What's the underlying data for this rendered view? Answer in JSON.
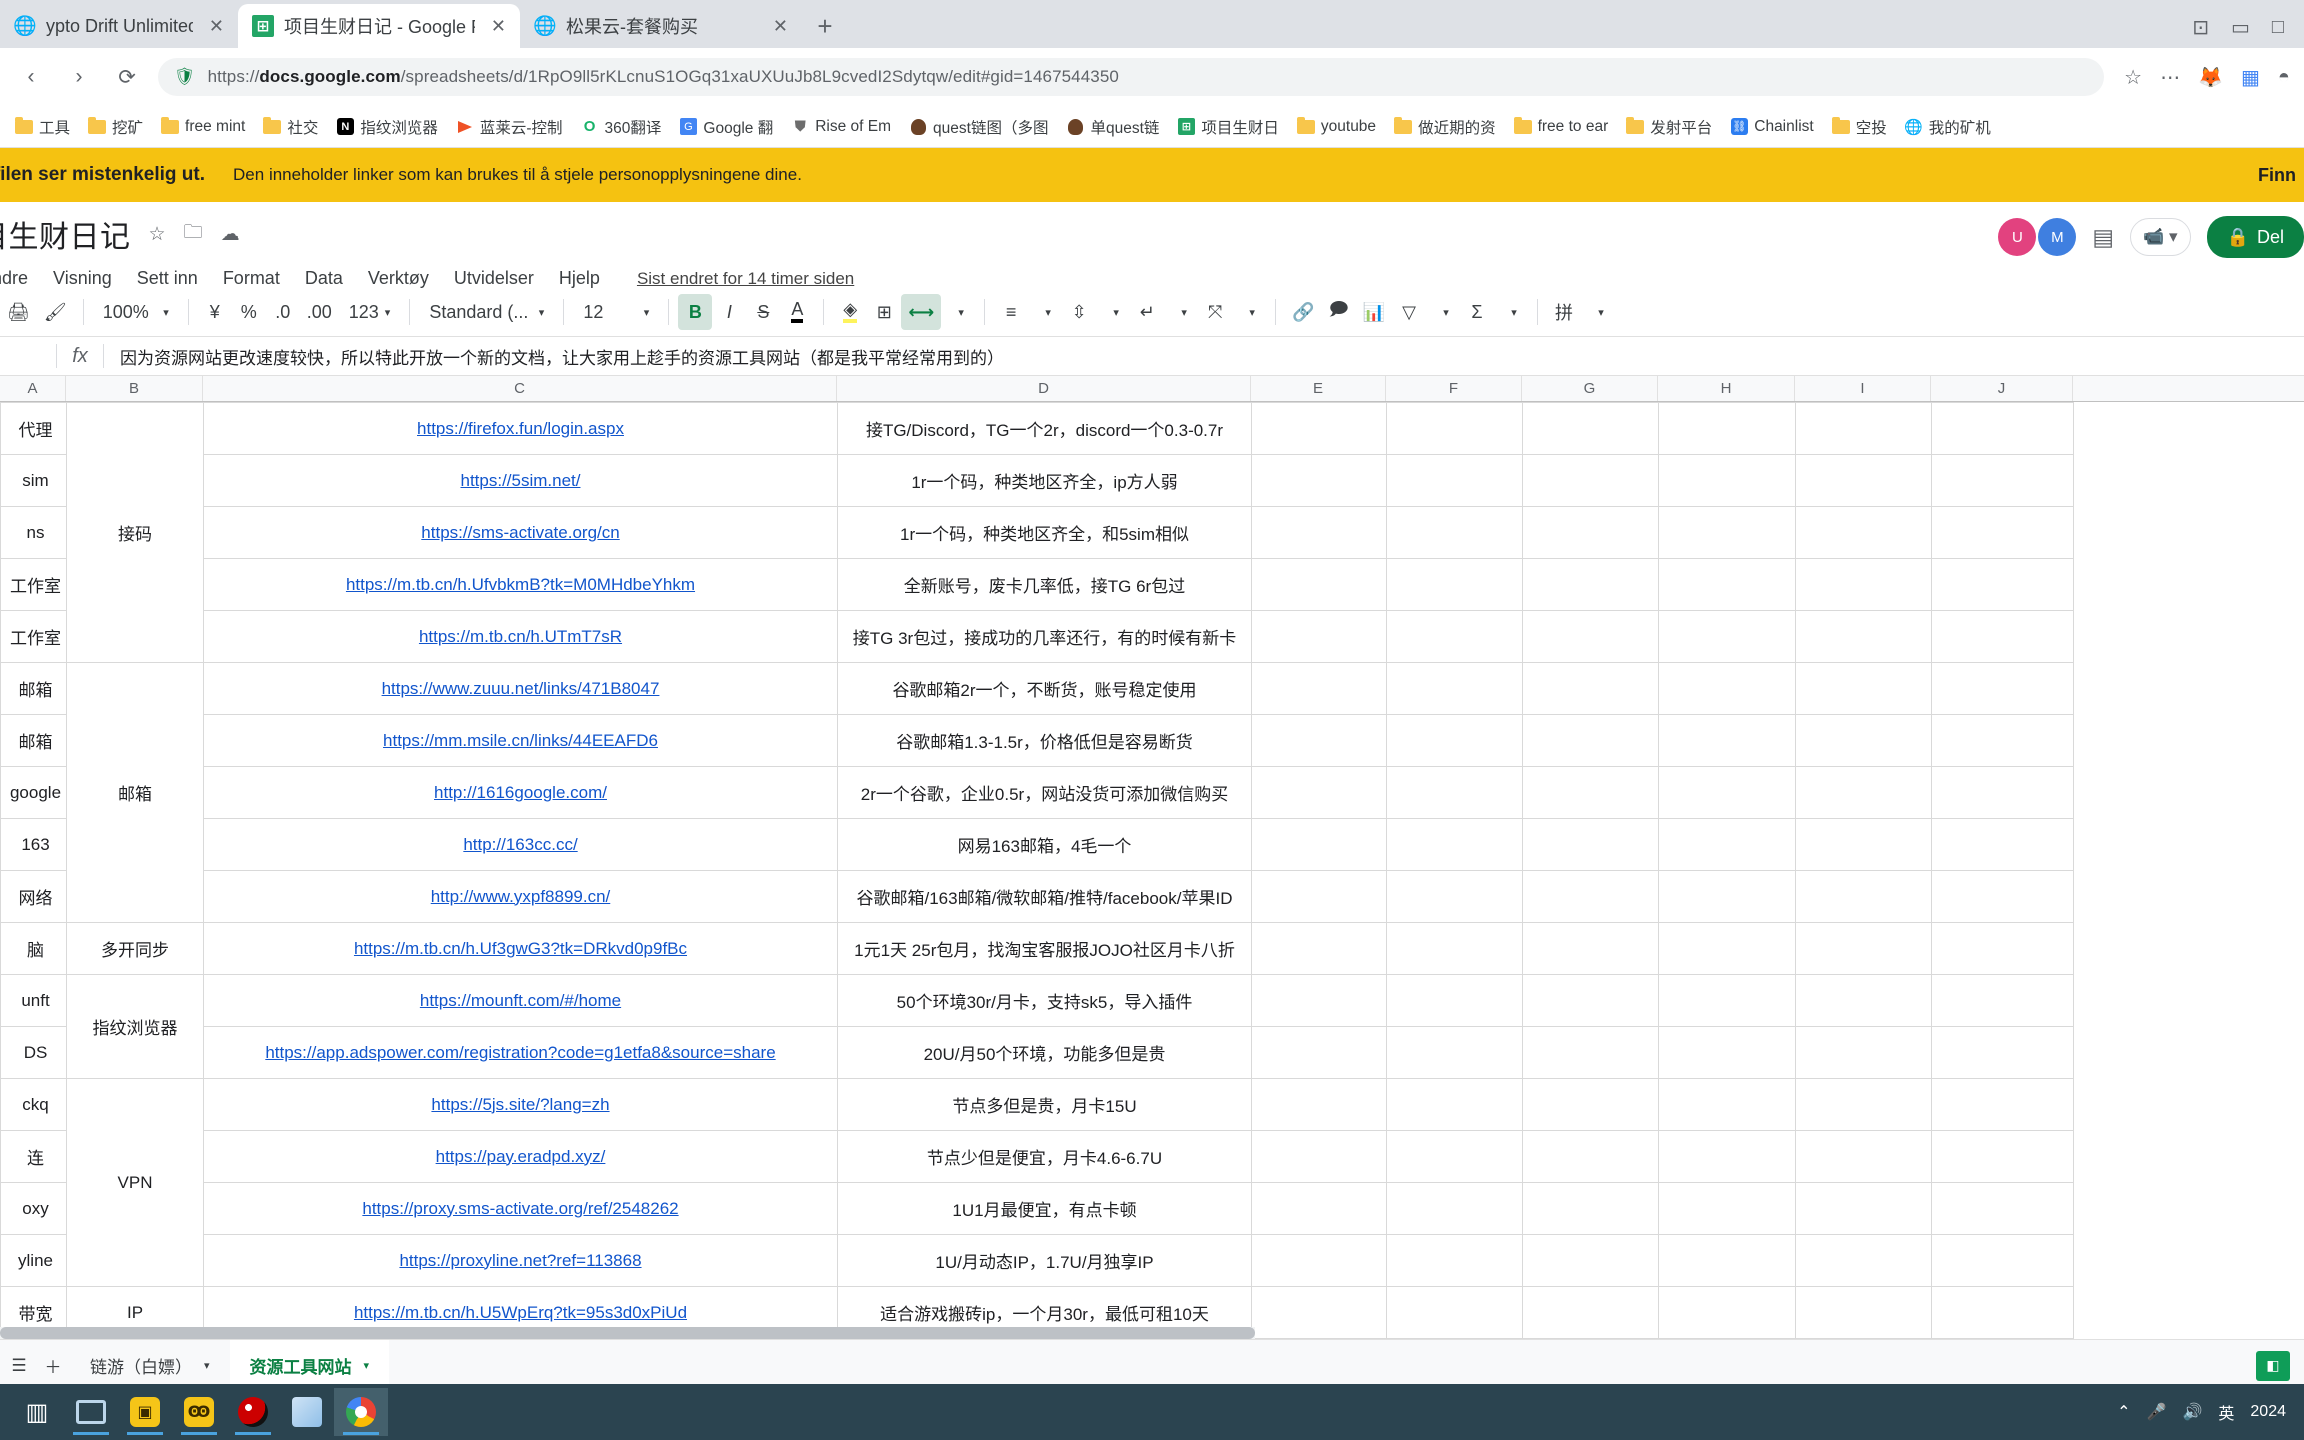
{
  "browser": {
    "tabs": [
      {
        "title": "ypto Drift Unlimited",
        "icon": "globe-icon",
        "active": false
      },
      {
        "title": "项目生财日记 - Google Reg",
        "icon": "sheets-icon",
        "active": true
      },
      {
        "title": "松果云-套餐购买",
        "icon": "globe-icon",
        "active": false
      }
    ],
    "new_tab_label": "+",
    "url_scheme": "https://",
    "url_domain": "docs.google.com",
    "url_path": "/spreadsheets/d/1RpO9ll5rKLcnuS1OGq31xaUXUuJb8L9cvedI2Sdytqw/edit#gid=1467544350",
    "nav": {
      "back": "‹",
      "forward": "›",
      "reload": "⟳"
    },
    "omni_icons": [
      "star-icon",
      "more-icon",
      "extension-icon",
      "apps-grid-icon",
      "profile-icon"
    ],
    "bookmarks": [
      {
        "label": "工具",
        "icon": "folder-icon"
      },
      {
        "label": "挖矿",
        "icon": "folder-icon"
      },
      {
        "label": "free mint",
        "icon": "folder-icon"
      },
      {
        "label": "社交",
        "icon": "folder-icon"
      },
      {
        "label": "指纹浏览器",
        "icon": "notion-icon"
      },
      {
        "label": "蓝莱云-控制",
        "icon": "flag-icon"
      },
      {
        "label": "360翻译",
        "icon": "360-icon"
      },
      {
        "label": "Google 翻",
        "icon": "gdrive-icon"
      },
      {
        "label": "Rise of Em",
        "icon": "shield-icon"
      },
      {
        "label": "quest链图（多图",
        "icon": "brown-icon"
      },
      {
        "label": "单quest链",
        "icon": "brown-icon"
      },
      {
        "label": "项目生财日",
        "icon": "sheets-icon"
      },
      {
        "label": "youtube",
        "icon": "folder-icon"
      },
      {
        "label": "做近期的资",
        "icon": "folder-icon"
      },
      {
        "label": "free to ear",
        "icon": "folder-icon"
      },
      {
        "label": "发射平台",
        "icon": "folder-icon"
      },
      {
        "label": "Chainlist",
        "icon": "chainlist-icon"
      },
      {
        "label": "空投",
        "icon": "folder-icon"
      },
      {
        "label": "我的矿机",
        "icon": "globe-icon"
      }
    ]
  },
  "warning": {
    "strong": "e filen ser mistenkelig ut.",
    "detail": "Den inneholder linker som kan brukes til å stjele personopplysningene dine.",
    "action": "Finn"
  },
  "sheets": {
    "doc_title": "目生财日记",
    "title_icons": [
      "star-icon",
      "move-to-folder-icon",
      "cloud-saved-icon"
    ],
    "menu": [
      "Endre",
      "Visning",
      "Sett inn",
      "Format",
      "Data",
      "Verktøy",
      "Utvidelser",
      "Hjelp"
    ],
    "last_edit": "Sist endret for 14 timer siden",
    "share_label": "Del",
    "header_icons": [
      "avatar-pink",
      "avatar-blue",
      "comment-history-icon",
      "meet-icon"
    ],
    "toolbar": {
      "zoom": "100%",
      "currency": "¥",
      "percent": "%",
      "dec_decrease": ".0",
      "dec_increase": ".00",
      "number_format": "123",
      "font": "Standard (...",
      "font_size": "12",
      "bold": "B",
      "italic": "I",
      "strike": "S",
      "text_color": "A",
      "fill_color": "◈",
      "borders": "⊞",
      "merge": "⟷",
      "align": "≡",
      "valign": "⇳",
      "wrap": "↵",
      "rotate": "⤧",
      "link": "🔗",
      "comment": "💬",
      "chart": "📊",
      "filter": "▽",
      "functions": "Σ",
      "pinyin": "拼"
    },
    "formula": {
      "name_box": "",
      "fx": "fx",
      "value": "因为资源网站更改速度较快，所以特此开放一个新的文档，让大家用上趁手的资源工具网站（都是我平常经常用到的）"
    },
    "columns": [
      "A",
      "B",
      "C",
      "D",
      "E",
      "F",
      "G",
      "H",
      "I",
      "J"
    ],
    "rows": [
      {
        "a": "代理",
        "b": "接码",
        "c": "https://firefox.fun/login.aspx",
        "d": "接TG/Discord，TG一个2r，discord一个0.3-0.7r"
      },
      {
        "a": "sim",
        "b": "",
        "c": "https://5sim.net/",
        "d": "1r一个码，种类地区齐全，ip方人弱"
      },
      {
        "a": "ns",
        "b": "",
        "c": "https://sms-activate.org/cn",
        "d": "1r一个码，种类地区齐全，和5sim相似"
      },
      {
        "a": "工作室",
        "b": "",
        "c": "https://m.tb.cn/h.UfvbkmB?tk=M0MHdbeYhkm",
        "d": "全新账号，废卡几率低，接TG 6r包过"
      },
      {
        "a": "工作室",
        "b": "",
        "c": "https://m.tb.cn/h.UTmT7sR",
        "d": "接TG 3r包过，接成功的几率还行，有的时候有新卡"
      },
      {
        "a": "邮箱",
        "b": "邮箱",
        "c": "https://www.zuuu.net/links/471B8047",
        "d": "谷歌邮箱2r一个，不断货，账号稳定使用"
      },
      {
        "a": "邮箱",
        "b": "",
        "c": "https://mm.msile.cn/links/44EEAFD6",
        "d": "谷歌邮箱1.3-1.5r，价格低但是容易断货"
      },
      {
        "a": "google",
        "b": "",
        "c": "http://1616google.com/",
        "d": "2r一个谷歌，企业0.5r，网站没货可添加微信购买"
      },
      {
        "a": "163",
        "b": "",
        "c": "http://163cc.cc/",
        "d": "网易163邮箱，4毛一个"
      },
      {
        "a": "网络",
        "b": "",
        "c": "http://www.yxpf8899.cn/",
        "d": "谷歌邮箱/163邮箱/微软邮箱/推特/facebook/苹果ID"
      },
      {
        "a": "脑",
        "b": "多开同步",
        "c": "https://m.tb.cn/h.Uf3gwG3?tk=DRkvd0p9fBc",
        "d": "1元1天 25r包月，找淘宝客服报JOJO社区月卡八折"
      },
      {
        "a": "unft",
        "b": "指纹浏览器",
        "c": "https://mounft.com/#/home",
        "d": "50个环境30r/月卡，支持sk5，导入插件"
      },
      {
        "a": "DS",
        "b": "",
        "c": "https://app.adspower.com/registration?code=g1etfa8&source=share",
        "d": "20U/月50个环境，功能多但是贵"
      },
      {
        "a": "ckq",
        "b": "VPN",
        "c": "https://5js.site/?lang=zh",
        "d": "节点多但是贵，月卡15U"
      },
      {
        "a": "连",
        "b": "",
        "c": "https://pay.eradpd.xyz/",
        "d": "节点少但是便宜，月卡4.6-6.7U"
      },
      {
        "a": "oxy",
        "b": "",
        "c": "https://proxy.sms-activate.org/ref/2548262",
        "d": "1U1月最便宜，有点卡顿"
      },
      {
        "a": "yline",
        "b": "",
        "c": "https://proxyline.net?ref=113868",
        "d": "1U/月动态IP，1.7U/月独享IP"
      },
      {
        "a": "带宽",
        "b": "IP",
        "c": "https://m.tb.cn/h.U5WpErq?tk=95s3d0xPiUd",
        "d": "适合游戏搬砖ip，一个月30r，最低可租10天"
      }
    ],
    "sheet_tabs": [
      {
        "label": "链游（白嫖）",
        "active": false
      },
      {
        "label": "资源工具网站",
        "active": true
      }
    ]
  },
  "taskbar": {
    "items": [
      "task-view-icon",
      "explorer-icon",
      "app-yellow-icon",
      "app-yellow2-icon",
      "pokeball-icon",
      "notes-icon",
      "chrome-icon"
    ],
    "tray": [
      "chevron-up-icon",
      "mic-icon",
      "volume-icon",
      "ime-label"
    ],
    "ime": "英",
    "clock": "2024"
  }
}
